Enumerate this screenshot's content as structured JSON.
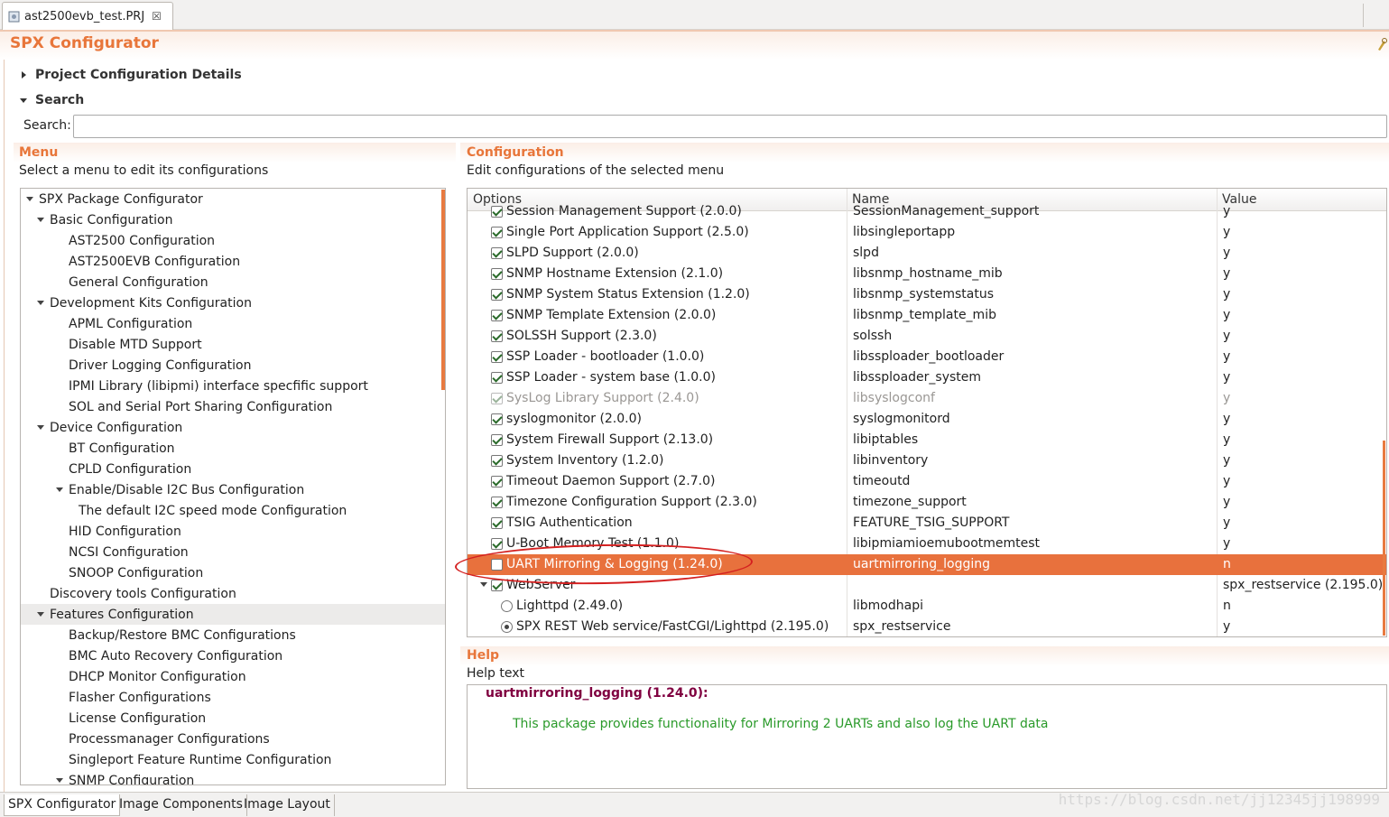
{
  "editor_tab": {
    "title": "ast2500evb_test.PRJ",
    "close_symbol": "☒"
  },
  "form": {
    "title": "SPX Configurator"
  },
  "sections": {
    "project_details": "Project Configuration Details",
    "search": "Search"
  },
  "search": {
    "label": "Search:",
    "value": "",
    "placeholder": ""
  },
  "menu": {
    "heading": "Menu",
    "subtitle": "Select a menu to edit its configurations",
    "items": [
      {
        "label": "SPX Package Configurator",
        "level": 0,
        "expanded": true
      },
      {
        "label": "Basic Configuration",
        "level": 1,
        "expanded": true
      },
      {
        "label": "AST2500 Configuration",
        "level": 2
      },
      {
        "label": "AST2500EVB  Configuration",
        "level": 2
      },
      {
        "label": "General Configuration",
        "level": 2
      },
      {
        "label": "Development Kits Configuration",
        "level": 1,
        "expanded": true
      },
      {
        "label": "APML Configuration",
        "level": 2
      },
      {
        "label": "Disable MTD Support",
        "level": 2
      },
      {
        "label": "Driver Logging Configuration",
        "level": 2
      },
      {
        "label": "IPMI Library (libipmi) interface specfific support",
        "level": 2
      },
      {
        "label": "SOL and Serial Port Sharing Configuration",
        "level": 2
      },
      {
        "label": "Device Configuration",
        "level": 1,
        "expanded": true
      },
      {
        "label": "BT Configuration",
        "level": 2
      },
      {
        "label": "CPLD Configuration",
        "level": 2
      },
      {
        "label": "Enable/Disable I2C Bus Configuration",
        "level": 2,
        "expanded": true
      },
      {
        "label": "The default I2C speed mode Configuration",
        "level": 3
      },
      {
        "label": "HID Configuration",
        "level": 2
      },
      {
        "label": "NCSI Configuration",
        "level": 2
      },
      {
        "label": "SNOOP Configuration",
        "level": 2
      },
      {
        "label": "Discovery tools Configuration",
        "level": 1
      },
      {
        "label": "Features Configuration",
        "level": 1,
        "expanded": true,
        "selected": true
      },
      {
        "label": "Backup/Restore BMC Configurations",
        "level": 2
      },
      {
        "label": "BMC Auto Recovery Configuration",
        "level": 2
      },
      {
        "label": "DHCP Monitor Configuration",
        "level": 2
      },
      {
        "label": "Flasher Configurations",
        "level": 2
      },
      {
        "label": "License Configuration",
        "level": 2
      },
      {
        "label": "Processmanager Configurations",
        "level": 2
      },
      {
        "label": "Singleport Feature Runtime Configuration",
        "level": 2
      },
      {
        "label": "SNMP Configuration",
        "level": 2,
        "expanded": true
      }
    ]
  },
  "configuration": {
    "heading": "Configuration",
    "subtitle": "Edit configurations of the selected menu",
    "columns": [
      "Options",
      "Name",
      "Value"
    ],
    "rows": [
      {
        "option": "Session Management Support (2.0.0)",
        "name": "SessionManagement_support",
        "value": "y",
        "checked": true
      },
      {
        "option": "Single Port Application Support (2.5.0)",
        "name": "libsingleportapp",
        "value": "y",
        "checked": true
      },
      {
        "option": "SLPD Support (2.0.0)",
        "name": "slpd",
        "value": "y",
        "checked": true
      },
      {
        "option": "SNMP Hostname Extension (2.1.0)",
        "name": "libsnmp_hostname_mib",
        "value": "y",
        "checked": true
      },
      {
        "option": "SNMP System Status Extension (1.2.0)",
        "name": "libsnmp_systemstatus",
        "value": "y",
        "checked": true
      },
      {
        "option": "SNMP Template Extension (2.0.0)",
        "name": "libsnmp_template_mib",
        "value": "y",
        "checked": true
      },
      {
        "option": "SOLSSH Support (2.3.0)",
        "name": "solssh",
        "value": "y",
        "checked": true
      },
      {
        "option": "SSP Loader - bootloader (1.0.0)",
        "name": "libssploader_bootloader",
        "value": "y",
        "checked": true
      },
      {
        "option": "SSP Loader - system base (1.0.0)",
        "name": "libssploader_system",
        "value": "y",
        "checked": true
      },
      {
        "option": "SysLog Library Support (2.4.0)",
        "name": "libsyslogconf",
        "value": "y",
        "checked": true,
        "disabled": true
      },
      {
        "option": "syslogmonitor (2.0.0)",
        "name": "syslogmonitord",
        "value": "y",
        "checked": true
      },
      {
        "option": "System Firewall Support (2.13.0)",
        "name": "libiptables",
        "value": "y",
        "checked": true
      },
      {
        "option": "System Inventory (1.2.0)",
        "name": "libinventory",
        "value": "y",
        "checked": true
      },
      {
        "option": "Timeout Daemon Support (2.7.0)",
        "name": "timeoutd",
        "value": "y",
        "checked": true
      },
      {
        "option": "Timezone Configuration Support (2.3.0)",
        "name": "timezone_support",
        "value": "y",
        "checked": true
      },
      {
        "option": "TSIG Authentication",
        "name": "FEATURE_TSIG_SUPPORT",
        "value": "y",
        "checked": true
      },
      {
        "option": "U-Boot Memory Test (1.1.0)",
        "name": "libipmiamioemubootmemtest",
        "value": "y",
        "checked": true
      },
      {
        "option": "UART Mirroring & Logging (1.24.0)",
        "name": "uartmirroring_logging",
        "value": "n",
        "checked": false,
        "selected": true
      },
      {
        "option": "WebServer",
        "name": "",
        "value": "spx_restservice (2.195.0)",
        "checked": true,
        "group": true
      },
      {
        "option": "Lighttpd (2.49.0)",
        "name": "libmodhapi",
        "value": "n",
        "radio": true,
        "checked": false
      },
      {
        "option": "SPX REST Web service/FastCGI/Lighttpd (2.195.0)",
        "name": "spx_restservice",
        "value": "y",
        "radio": true,
        "checked": true
      }
    ]
  },
  "help": {
    "heading": "Help",
    "subtitle": "Help text",
    "package": "uartmirroring_logging (1.24.0):",
    "description": "This package provides functionality for Mirroring 2 UARTs and also log the UART data"
  },
  "bottom_tabs": [
    "SPX Configurator",
    "Image Components",
    "Image Layout"
  ],
  "watermark": "https://blog.csdn.net/jj12345jj198999",
  "colors": {
    "accent": "#e8763a",
    "selection": "#e8713d",
    "help_package": "#800040",
    "help_text": "#2a9a2a",
    "annotation": "#d42020"
  },
  "icons": {
    "file": "project-file-icon",
    "tool": "tool-icon"
  }
}
